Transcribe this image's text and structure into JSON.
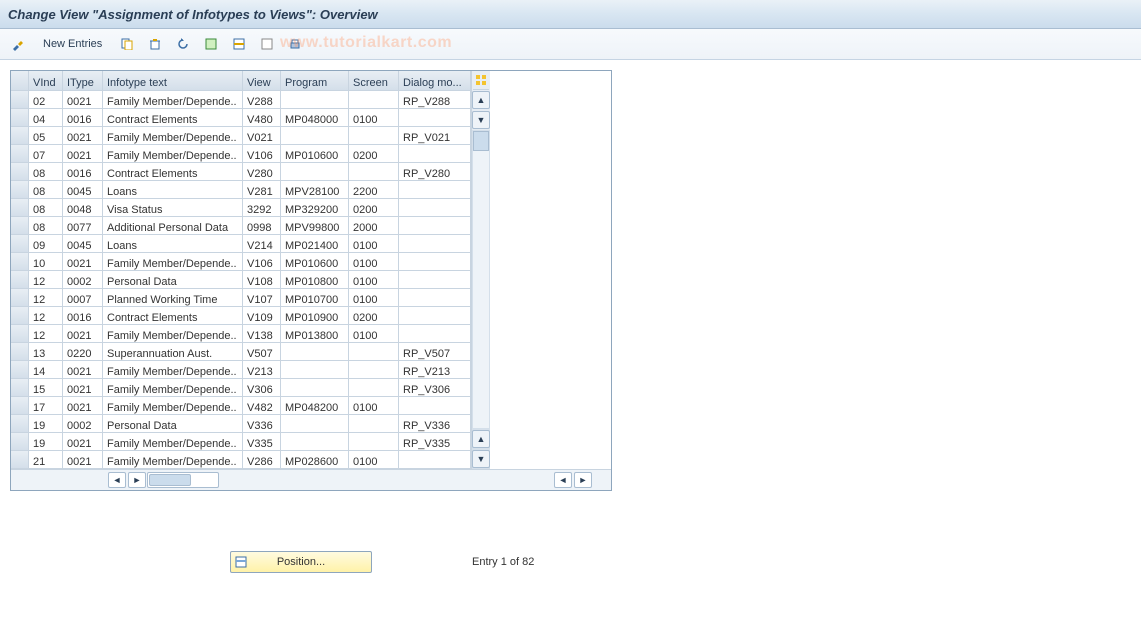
{
  "title": "Change View \"Assignment of Infotypes to Views\": Overview",
  "toolbar": {
    "new_entries": "New Entries"
  },
  "watermark": "www.tutorialkart.com",
  "columns": [
    "VInd",
    "IType",
    "Infotype text",
    "View",
    "Program",
    "Screen",
    "Dialog mo..."
  ],
  "rows": [
    {
      "vind": "02",
      "itype": "0021",
      "text": "Family Member/Depende..",
      "view": "V288",
      "program": "",
      "screen": "",
      "dialog": "RP_V288"
    },
    {
      "vind": "04",
      "itype": "0016",
      "text": "Contract Elements",
      "view": "V480",
      "program": "MP048000",
      "screen": "0100",
      "dialog": ""
    },
    {
      "vind": "05",
      "itype": "0021",
      "text": "Family Member/Depende..",
      "view": "V021",
      "program": "",
      "screen": "",
      "dialog": "RP_V021"
    },
    {
      "vind": "07",
      "itype": "0021",
      "text": "Family Member/Depende..",
      "view": "V106",
      "program": "MP010600",
      "screen": "0200",
      "dialog": ""
    },
    {
      "vind": "08",
      "itype": "0016",
      "text": "Contract Elements",
      "view": "V280",
      "program": "",
      "screen": "",
      "dialog": "RP_V280"
    },
    {
      "vind": "08",
      "itype": "0045",
      "text": "Loans",
      "view": "V281",
      "program": "MPV28100",
      "screen": "2200",
      "dialog": ""
    },
    {
      "vind": "08",
      "itype": "0048",
      "text": "Visa Status",
      "view": "3292",
      "program": "MP329200",
      "screen": "0200",
      "dialog": ""
    },
    {
      "vind": "08",
      "itype": "0077",
      "text": "Additional Personal Data",
      "view": "0998",
      "program": "MPV99800",
      "screen": "2000",
      "dialog": ""
    },
    {
      "vind": "09",
      "itype": "0045",
      "text": "Loans",
      "view": "V214",
      "program": "MP021400",
      "screen": "0100",
      "dialog": ""
    },
    {
      "vind": "10",
      "itype": "0021",
      "text": "Family Member/Depende..",
      "view": "V106",
      "program": "MP010600",
      "screen": "0100",
      "dialog": ""
    },
    {
      "vind": "12",
      "itype": "0002",
      "text": "Personal Data",
      "view": "V108",
      "program": "MP010800",
      "screen": "0100",
      "dialog": ""
    },
    {
      "vind": "12",
      "itype": "0007",
      "text": "Planned Working Time",
      "view": "V107",
      "program": "MP010700",
      "screen": "0100",
      "dialog": ""
    },
    {
      "vind": "12",
      "itype": "0016",
      "text": "Contract Elements",
      "view": "V109",
      "program": "MP010900",
      "screen": "0200",
      "dialog": ""
    },
    {
      "vind": "12",
      "itype": "0021",
      "text": "Family Member/Depende..",
      "view": "V138",
      "program": "MP013800",
      "screen": "0100",
      "dialog": ""
    },
    {
      "vind": "13",
      "itype": "0220",
      "text": "Superannuation Aust.",
      "view": "V507",
      "program": "",
      "screen": "",
      "dialog": "RP_V507"
    },
    {
      "vind": "14",
      "itype": "0021",
      "text": "Family Member/Depende..",
      "view": "V213",
      "program": "",
      "screen": "",
      "dialog": "RP_V213"
    },
    {
      "vind": "15",
      "itype": "0021",
      "text": "Family Member/Depende..",
      "view": "V306",
      "program": "",
      "screen": "",
      "dialog": "RP_V306"
    },
    {
      "vind": "17",
      "itype": "0021",
      "text": "Family Member/Depende..",
      "view": "V482",
      "program": "MP048200",
      "screen": "0100",
      "dialog": ""
    },
    {
      "vind": "19",
      "itype": "0002",
      "text": "Personal Data",
      "view": "V336",
      "program": "",
      "screen": "",
      "dialog": "RP_V336"
    },
    {
      "vind": "19",
      "itype": "0021",
      "text": "Family Member/Depende..",
      "view": "V335",
      "program": "",
      "screen": "",
      "dialog": "RP_V335"
    },
    {
      "vind": "21",
      "itype": "0021",
      "text": "Family Member/Depende..",
      "view": "V286",
      "program": "MP028600",
      "screen": "0100",
      "dialog": ""
    }
  ],
  "footer": {
    "position_label": "Position...",
    "entry_text": "Entry 1 of 82"
  }
}
